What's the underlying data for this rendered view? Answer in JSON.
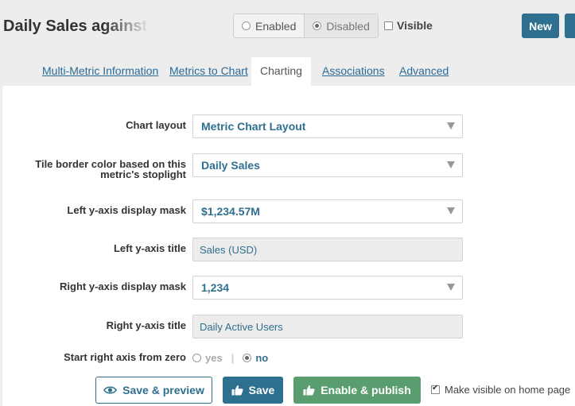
{
  "header": {
    "title": "Daily Sales against",
    "state": {
      "enabled_label": "Enabled",
      "disabled_label": "Disabled",
      "selected": "Disabled"
    },
    "visible_label": "Visible",
    "visible_checked": false,
    "new_label": "New"
  },
  "tabs": [
    {
      "label": "Multi-Metric Information",
      "active": false
    },
    {
      "label": "Metrics to Chart",
      "active": false
    },
    {
      "label": "Charting",
      "active": true
    },
    {
      "label": "Associations",
      "active": false
    },
    {
      "label": "Advanced",
      "active": false
    }
  ],
  "form": {
    "chart_layout": {
      "label": "Chart layout",
      "value": "Metric Chart Layout"
    },
    "tile_border": {
      "label_line1": "Tile border color based on this",
      "label_line2": "metric's stoplight",
      "value": "Daily Sales"
    },
    "left_mask": {
      "label": "Left y-axis display mask",
      "value": "$1,234.57M"
    },
    "left_title": {
      "label": "Left y-axis title",
      "value": "Sales (USD)"
    },
    "right_mask": {
      "label": "Right y-axis display mask",
      "value": "1,234"
    },
    "right_title": {
      "label": "Right y-axis title",
      "value": "Daily Active Users"
    },
    "start_zero": {
      "label": "Start right axis from zero",
      "yes": "yes",
      "no": "no",
      "selected": "no"
    }
  },
  "actions": {
    "preview_label": "Save & preview",
    "save_label": "Save",
    "publish_label": "Enable & publish",
    "home_visible_label": "Make visible on home page",
    "home_visible_checked": true
  },
  "colors": {
    "primary": "#2f6f8f",
    "publish": "#5a9e6f",
    "background": "#ededed"
  }
}
